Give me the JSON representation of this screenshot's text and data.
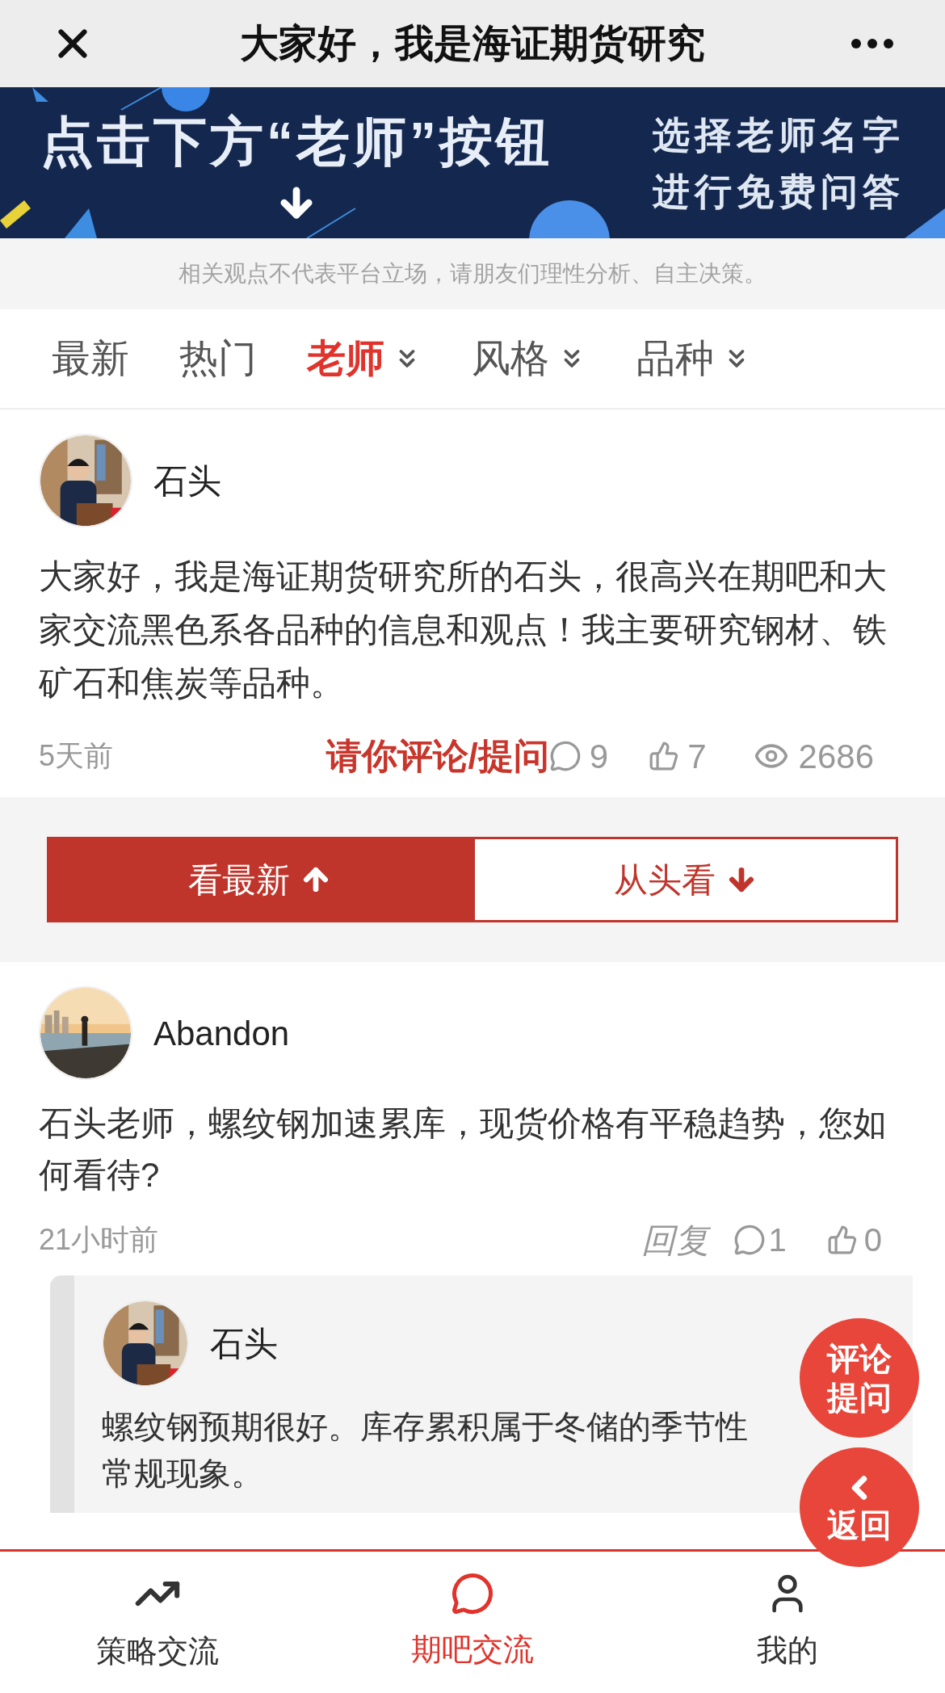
{
  "header": {
    "title": "大家好，我是海证期货研究"
  },
  "banner": {
    "headline": "点击下方“老师”按钮",
    "lines": [
      "选择老师名字",
      "进行免费问答"
    ]
  },
  "disclaimer": "相关观点不代表平台立场，请朋友们理性分析、自主决策。",
  "tabs": [
    {
      "label": "最新",
      "selected": false,
      "dropdown": false
    },
    {
      "label": "热门",
      "selected": false,
      "dropdown": false
    },
    {
      "label": "老师",
      "selected": true,
      "dropdown": true
    },
    {
      "label": "风格",
      "selected": false,
      "dropdown": true
    },
    {
      "label": "品种",
      "selected": false,
      "dropdown": true
    }
  ],
  "post": {
    "author": "石头",
    "text": "大家好，我是海证期货研究所的石头，很高兴在期吧和大家交流黑色系各品种的信息和观点！我主要研究钢材、铁矿石和焦炭等品种。",
    "time": "5天前",
    "cta": "请你评论/提问",
    "comments": "9",
    "likes": "7",
    "views": "2686"
  },
  "sort_buttons": [
    {
      "label": "看最新",
      "selected": true
    },
    {
      "label": "从头看",
      "selected": false
    }
  ],
  "comment": {
    "author": "Abandon",
    "text": "石头老师，螺纹钢加速累库，现货价格有平稳趋势，您如何看待?",
    "time": "21小时前",
    "reply_label": "回复",
    "comments": "1",
    "likes": "0",
    "reply": {
      "author": "石头",
      "text": "螺纹钢预期很好。库存累积属于冬储的季节性常规现象。"
    }
  },
  "floating_buttons": [
    {
      "kind": "comment",
      "lines": [
        "评论",
        "提问"
      ]
    },
    {
      "kind": "back",
      "lines": [
        "返回"
      ]
    }
  ],
  "bottom_nav": [
    {
      "label": "策略交流",
      "selected": false
    },
    {
      "label": "期吧交流",
      "selected": true
    },
    {
      "label": "我的",
      "selected": false
    }
  ]
}
